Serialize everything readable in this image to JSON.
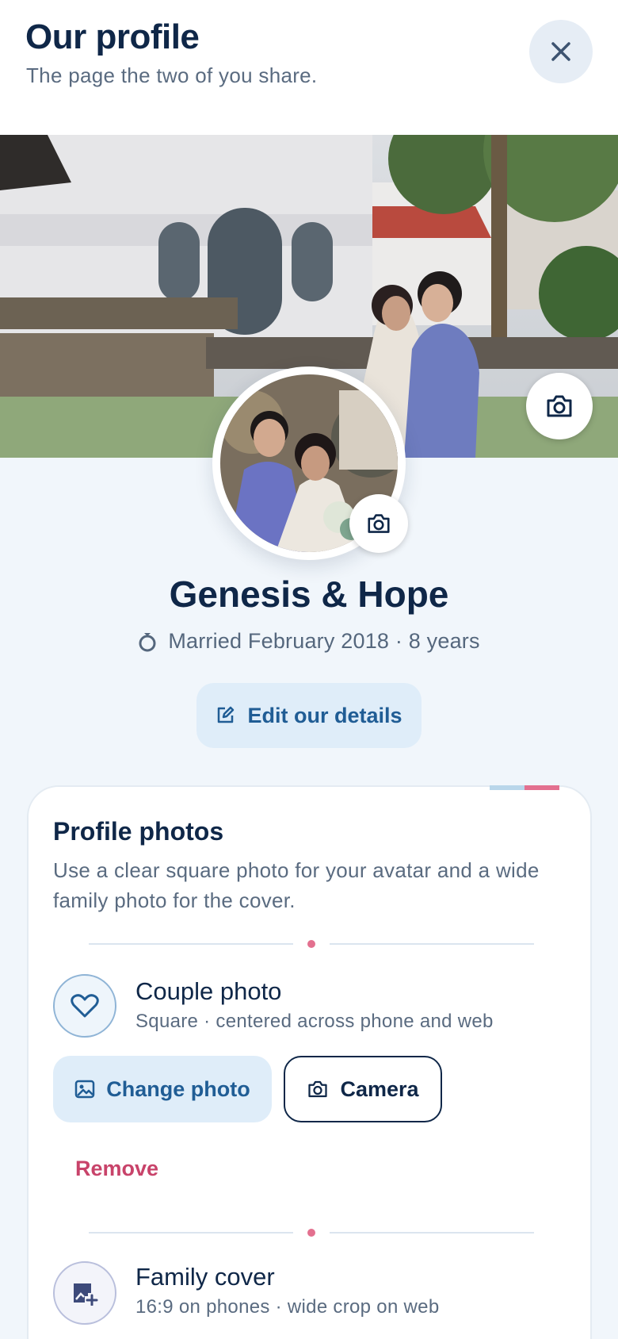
{
  "header": {
    "title": "Our profile",
    "subtitle": "The page the two of you share.",
    "close_icon": "close-icon"
  },
  "cover": {
    "image": "wedding couple in front of white building",
    "camera_icon": "camera-icon"
  },
  "avatar": {
    "image": "couple portrait",
    "camera_icon": "camera-icon"
  },
  "profile": {
    "name": "Genesis & Hope",
    "married_text": "Married February 2018 · 8 years",
    "ring_icon": "ring-icon",
    "edit_label": "Edit our details",
    "edit_icon": "edit-icon"
  },
  "photos_card": {
    "title": "Profile photos",
    "description": "Use a clear square photo for your avatar and a wide family photo for the cover.",
    "couple_photo": {
      "title": "Couple photo",
      "subtitle": "Square · centered across phone and web",
      "icon": "heart-icon",
      "change_label": "Change photo",
      "change_icon": "image-icon",
      "camera_label": "Camera",
      "camera_icon": "camera-icon",
      "remove_label": "Remove"
    },
    "family_cover": {
      "title": "Family cover",
      "subtitle": "16:9 on phones · wide crop on web",
      "icon": "add-photo-icon"
    }
  },
  "colors": {
    "primary_navy": "#0f2748",
    "accent_blue": "#205d95",
    "soft_blue_bg": "#dfedf9",
    "remove_pink": "#c8436a",
    "page_bg": "#f1f6fb"
  }
}
